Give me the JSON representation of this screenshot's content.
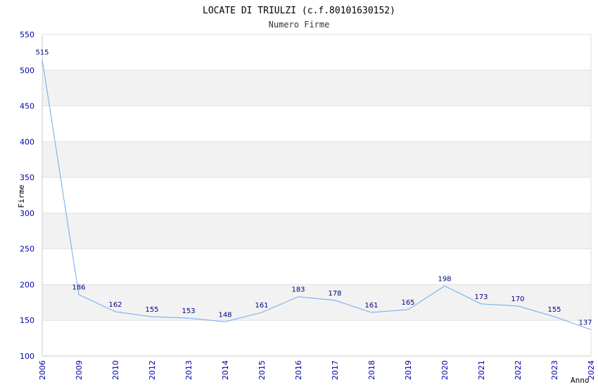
{
  "chart_data": {
    "type": "line",
    "title": "LOCATE DI TRIULZI (c.f.80101630152)",
    "subtitle": "Numero Firme",
    "xlabel": "Anno",
    "ylabel": "Firme",
    "categories": [
      "2006",
      "2009",
      "2010",
      "2012",
      "2013",
      "2014",
      "2015",
      "2016",
      "2017",
      "2018",
      "2019",
      "2020",
      "2021",
      "2022",
      "2023",
      "2024"
    ],
    "values": [
      515,
      186,
      162,
      155,
      153,
      148,
      161,
      183,
      178,
      161,
      165,
      198,
      173,
      170,
      155,
      137
    ],
    "ylim": [
      100,
      550
    ],
    "yticks": [
      100,
      150,
      200,
      250,
      300,
      350,
      400,
      450,
      500,
      550
    ],
    "grid": true,
    "colors": {
      "line": "#6aaaf0",
      "band": "#f2f2f2",
      "tick_text": "#0000aa",
      "label_text": "#000080"
    }
  }
}
